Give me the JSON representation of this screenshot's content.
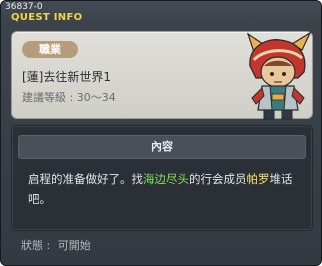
{
  "window": {
    "quest_id": "36837-0",
    "title": "QUEST INFO"
  },
  "header": {
    "job_badge": "職業",
    "quest_name": "[蓮]去往新世界1",
    "level_label": "建議等級 :",
    "level_value": "30～34",
    "npc_icon": "npc-character-icon"
  },
  "content": {
    "title": "內容",
    "text_before": "启程的准备做好了。找",
    "place": "海边尽头",
    "text_middle": "的行会成员",
    "npc_name": "帕罗",
    "text_after": "堆话吧。"
  },
  "status": {
    "label": "狀態 :",
    "value": "可開始"
  },
  "colors": {
    "title": "#f2d64a",
    "place_highlight": "#82e05a",
    "npc_highlight": "#ffe26a",
    "badge": "#b79c7c"
  }
}
